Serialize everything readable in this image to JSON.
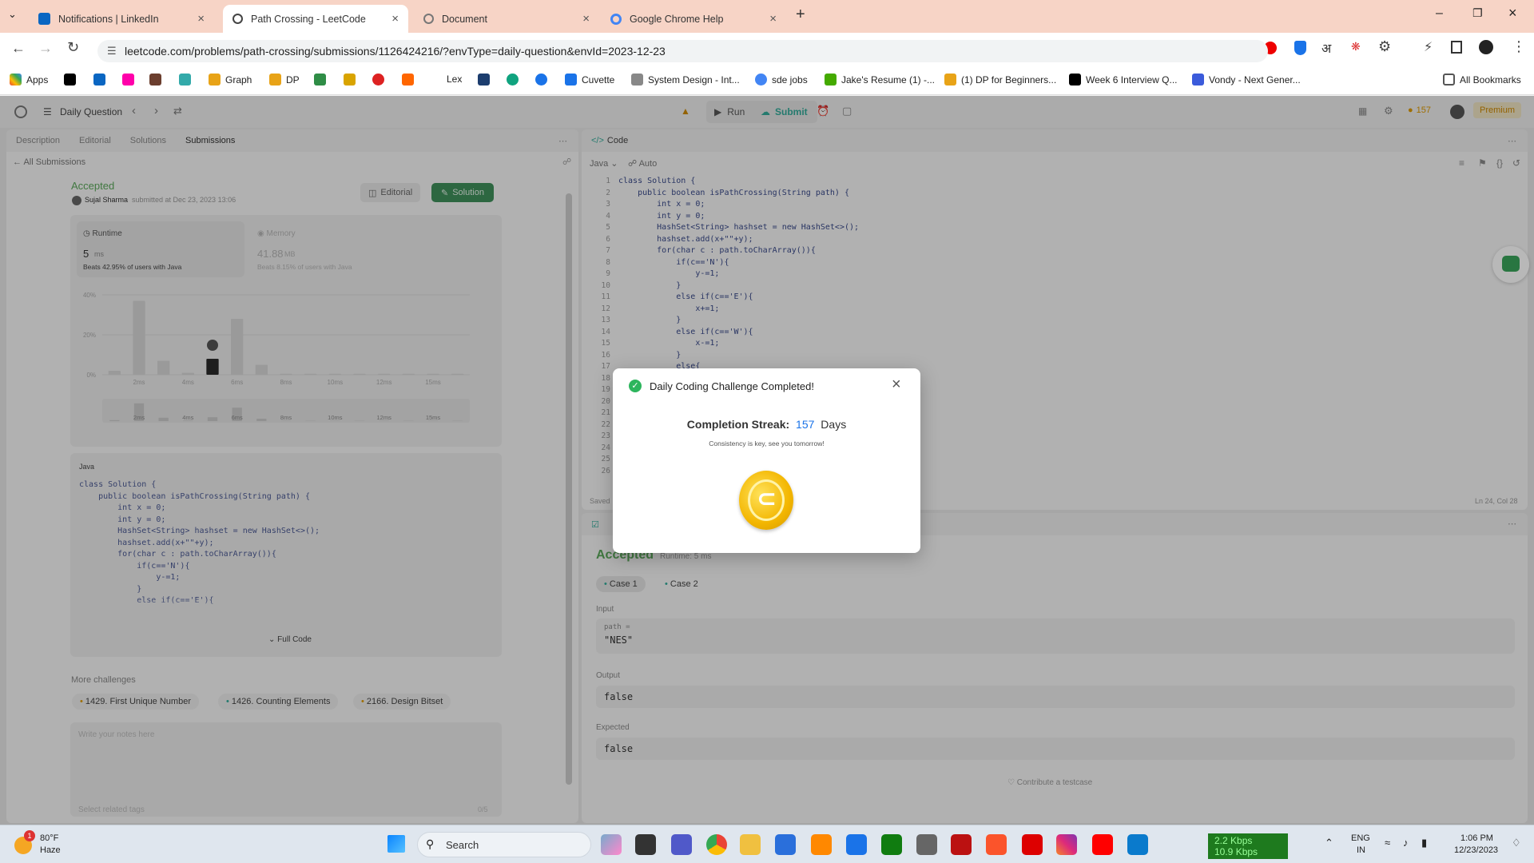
{
  "browser": {
    "tabs": [
      {
        "title": "Notifications | LinkedIn",
        "color": "#0a66c2"
      },
      {
        "title": "Path Crossing - LeetCode",
        "color": "#444444"
      },
      {
        "title": "Document",
        "color": "#777777"
      },
      {
        "title": "Google Chrome Help",
        "color": "#4285f4"
      }
    ],
    "url": "leetcode.com/problems/path-crossing/submissions/1126424216/?envType=daily-question&envId=2023-12-23",
    "bookmarks": [
      "Apps",
      "Graph",
      "DP",
      "Lex",
      "Cuvette",
      "System Design - Int...",
      "sde jobs",
      "Jake's Resume (1) -...",
      "(1) DP for Beginners...",
      "Week 6 Interview Q...",
      "Vondy - Next Gener...",
      "All Bookmarks"
    ]
  },
  "nav": {
    "daily": "Daily Question",
    "run": "Run",
    "submit": "Submit",
    "streak": "157",
    "premium": "Premium"
  },
  "left": {
    "tabs": [
      "Description",
      "Editorial",
      "Solutions",
      "Submissions"
    ],
    "all_submissions": "All Submissions",
    "status": "Accepted",
    "author": "Sujal Sharma",
    "submitted": "submitted at Dec 23, 2023 13:06",
    "editorial_btn": "Editorial",
    "solution_btn": "Solution",
    "runtime_label": "Runtime",
    "runtime_value": "5",
    "runtime_unit": "ms",
    "runtime_beats": "Beats 42.95% of users with Java",
    "memory_label": "Memory",
    "memory_value": "41.88",
    "memory_unit": "MB",
    "memory_beats": "Beats 8.15% of users with Java",
    "y_ticks": [
      "40%",
      "20%",
      "0%"
    ],
    "x_ticks": [
      "2ms",
      "4ms",
      "6ms",
      "8ms",
      "10ms",
      "12ms",
      "15ms"
    ],
    "x_ticks_nav": [
      "2ms",
      "4ms",
      "6ms",
      "8ms",
      "10ms",
      "12ms",
      "15ms"
    ],
    "lang": "Java",
    "code": "class Solution {\n    public boolean isPathCrossing(String path) {\n        int x = 0;\n        int y = 0;\n        HashSet<String> hashset = new HashSet<>();\n        hashset.add(x+\"\"+y);\n        for(char c : path.toCharArray()){\n            if(c=='N'){\n                y-=1;\n            }\n            else if(c=='E'){",
    "full_code": "Full Code",
    "more": "More challenges",
    "challenges": [
      "1429. First Unique Number",
      "1426. Counting Elements",
      "2166. Design Bitset"
    ],
    "notes_placeholder": "Write your notes here",
    "tags_placeholder": "Select related tags",
    "tags_count": "0/5"
  },
  "chart_data": {
    "type": "bar",
    "categories": [
      "1ms",
      "2ms",
      "3ms",
      "4ms",
      "5ms",
      "6ms",
      "7ms",
      "8ms",
      "9ms",
      "10ms",
      "11ms",
      "12ms",
      "13ms",
      "14ms",
      "15ms"
    ],
    "values": [
      2,
      37,
      7,
      1,
      8,
      28,
      5,
      0.5,
      0.5,
      0.5,
      0.5,
      0.5,
      0.5,
      0.5,
      0.5
    ],
    "highlight": "5ms",
    "ylim": [
      0,
      40
    ]
  },
  "editor": {
    "title": "Code",
    "lang": "Java",
    "mode": "Auto",
    "line_numbers": "1\n2\n3\n4\n5\n6\n7\n8\n9\n10\n11\n12\n13\n14\n15\n16\n17\n18\n19\n20\n21\n22\n23\n24\n25\n26",
    "code": "class Solution {\n    public boolean isPathCrossing(String path) {\n        int x = 0;\n        int y = 0;\n        HashSet<String> hashset = new HashSet<>();\n        hashset.add(x+\"\"+y);\n        for(char c : path.toCharArray()){\n            if(c=='N'){\n                y-=1;\n            }\n            else if(c=='E'){\n                x+=1;\n            }\n            else if(c=='W'){\n                x-=1;\n            }\n            else{",
    "saved": "Saved",
    "cursor": "Ln 24, Col 28"
  },
  "result": {
    "status": "Accepted",
    "runtime": "Runtime: 5 ms",
    "cases": [
      "Case 1",
      "Case 2"
    ],
    "input_label": "Input",
    "param": "path =",
    "input_value": "\"NES\"",
    "output_label": "Output",
    "output_value": "false",
    "expected_label": "Expected",
    "expected_value": "false",
    "contribute": "Contribute a testcase"
  },
  "modal": {
    "title": "Daily Coding Challenge Completed!",
    "streak_label": "Completion Streak:",
    "streak_value": "157",
    "streak_unit": "Days",
    "subtitle": "Consistency is key, see you tomorrow!"
  },
  "taskbar": {
    "temp": "80°F",
    "weather": "Haze",
    "search": "Search",
    "net_up": "2.2 Kbps",
    "net_down": "10.9 Kbps",
    "lang1": "ENG",
    "lang2": "IN",
    "time": "1:06 PM",
    "date": "12/23/2023",
    "badge": "1"
  }
}
